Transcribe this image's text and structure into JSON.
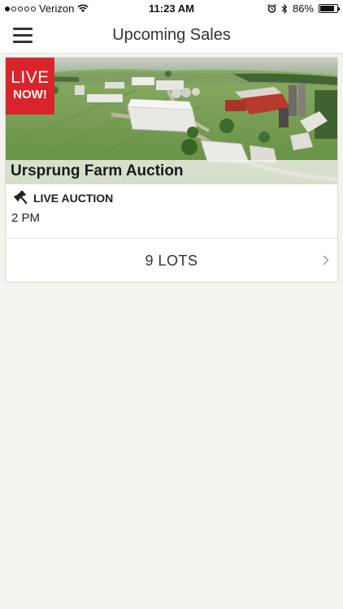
{
  "status_bar": {
    "carrier": "Verizon",
    "time": "11:23 AM",
    "battery": "86%",
    "battery_level": 0.86,
    "signal_bars": 1,
    "icons": [
      "signal-dots-icon",
      "wifi-icon",
      "alarm-icon",
      "bluetooth-icon",
      "battery-icon"
    ]
  },
  "nav": {
    "title": "Upcoming Sales",
    "menu_icon": "hamburger-menu-icon"
  },
  "sale": {
    "badge_line1": "LIVE",
    "badge_line2": "NOW!",
    "badge_color": "#d8242a",
    "title": "Ursprung Farm Auction",
    "type_icon": "gavel-icon",
    "type": "LIVE AUCTION",
    "time": "2 PM",
    "lots": "9 LOTS",
    "lots_icon": "chevron-right-icon"
  }
}
